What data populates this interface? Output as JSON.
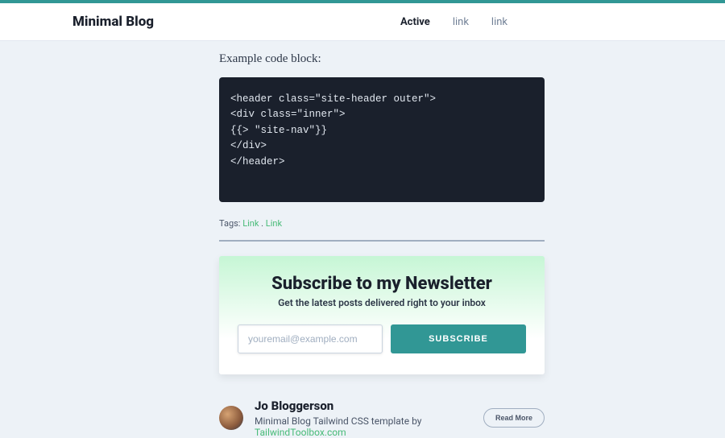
{
  "header": {
    "brand": "Minimal Blog",
    "nav": [
      {
        "label": "Active",
        "active": true
      },
      {
        "label": "link",
        "active": false
      },
      {
        "label": "link",
        "active": false
      }
    ]
  },
  "article": {
    "caption": "Example code block:",
    "code": "<header class=\"site-header outer\">\n<div class=\"inner\">\n{{> \"site-nav\"}}\n</div>\n</header>",
    "tags_label": "Tags: ",
    "tag_sep": " . ",
    "tags": [
      "Link",
      "Link"
    ]
  },
  "newsletter": {
    "title": "Subscribe to my Newsletter",
    "subtitle": "Get the latest posts delivered right to your inbox",
    "placeholder": "youremail@example.com",
    "button": "SUBSCRIBE"
  },
  "author": {
    "name": "Jo Bloggerson",
    "bio_prefix": "Minimal Blog Tailwind CSS template by ",
    "bio_link_text": "TailwindToolbox.com",
    "readmore": "Read More"
  }
}
